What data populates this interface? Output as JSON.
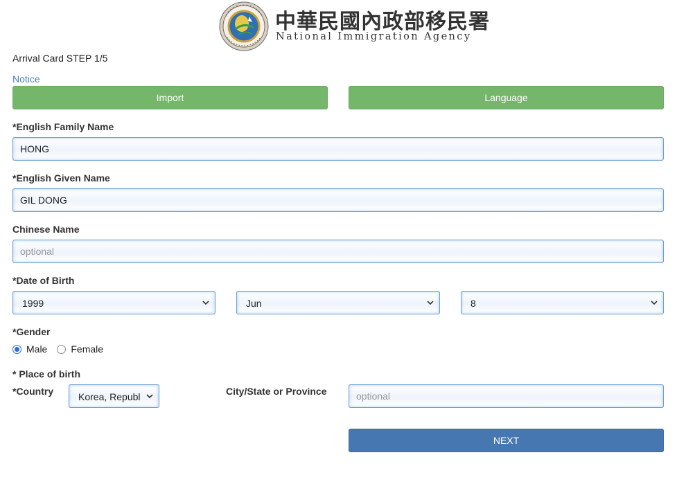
{
  "header": {
    "agency_name_zh": "中華民國內政部移民署",
    "agency_name_en": "National Immigration Agency"
  },
  "form": {
    "step_title": "Arrival Card STEP 1/5",
    "notice_link": "Notice",
    "import_button": "Import",
    "language_button": "Language",
    "family_name": {
      "label": "*English Family Name",
      "value": "HONG"
    },
    "given_name": {
      "label": "*English Given Name",
      "value": "GIL DONG"
    },
    "chinese_name": {
      "label": "Chinese Name",
      "placeholder": "optional"
    },
    "date_of_birth": {
      "label": "*Date of Birth",
      "year": "1999",
      "month": "Jun",
      "day": "8"
    },
    "gender": {
      "label": "*Gender",
      "options": [
        "Male",
        "Female"
      ],
      "selected": "Male"
    },
    "place_of_birth": {
      "label": "* Place of birth",
      "country_label": "*Country",
      "country_value": "Korea, Republi",
      "city_label": "City/State or Province",
      "city_placeholder": "optional"
    },
    "next_button": "NEXT"
  },
  "colors": {
    "green_button": "#74b66a",
    "next_button": "#4677b0",
    "link": "#4a7fb8",
    "input_border": "#6a9fd0"
  },
  "icons": [
    "emblem-logo",
    "chevron-down-icon"
  ]
}
